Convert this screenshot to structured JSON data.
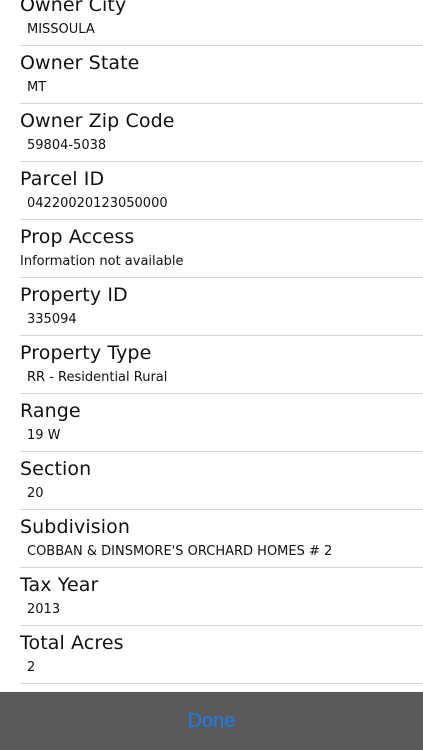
{
  "fields": [
    {
      "label": "Owner City",
      "value": "MISSOULA"
    },
    {
      "label": "Owner State",
      "value": "MT"
    },
    {
      "label": "Owner Zip Code",
      "value": "59804-5038"
    },
    {
      "label": "Parcel ID",
      "value": "04220020123050000"
    },
    {
      "label": "Prop Access",
      "value": "Information not available"
    },
    {
      "label": "Property ID",
      "value": "335094"
    },
    {
      "label": "Property Type",
      "value": "RR - Residential Rural"
    },
    {
      "label": "Range",
      "value": "19 W"
    },
    {
      "label": "Section",
      "value": "20"
    },
    {
      "label": "Subdivision",
      "value": "COBBAN & DINSMORE'S ORCHARD HOMES # 2"
    },
    {
      "label": "Tax Year",
      "value": "2013"
    },
    {
      "label": "Total Acres",
      "value": "2"
    }
  ],
  "footer": {
    "done_label": "Done"
  },
  "colors": {
    "accent": "#1a7cf2",
    "bar": "#5a5a5a",
    "divider": "#d6d6d6"
  }
}
